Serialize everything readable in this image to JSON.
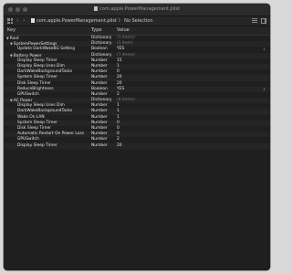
{
  "window": {
    "title": "com.apple.PowerManagement.plist",
    "breadcrumb_file": "com.apple.PowerManagement.plist",
    "breadcrumb_sep": "〉",
    "breadcrumb_selection": "No Selection",
    "traffic_lights": {
      "close": "#5c5c5c",
      "minimize": "#5c5c5c",
      "zoom": "#5c5c5c"
    }
  },
  "toolbar": {
    "back_icon": "‹",
    "forward_icon": "›"
  },
  "columns": {
    "key": "Key",
    "type": "Type",
    "value": "Value"
  },
  "rows": [
    {
      "level": 0,
      "disclosure": "▼",
      "key": "Root",
      "type": "Dictionary",
      "value": "(3 items)",
      "muted": true
    },
    {
      "level": 1,
      "disclosure": "▼",
      "key": "SystemPowerSettings",
      "type": "Dictionary",
      "value": "(1 item)",
      "muted": true
    },
    {
      "level": 2,
      "disclosure": "",
      "key": "Update DarkWakeBG Setting",
      "type": "Boolean",
      "value": "YES",
      "stepper": true
    },
    {
      "level": 1,
      "disclosure": "▼",
      "key": "Battery Power",
      "type": "Dictionary",
      "value": "(7 items)",
      "muted": true
    },
    {
      "level": 2,
      "disclosure": "",
      "key": "Display Sleep Timer",
      "type": "Number",
      "value": "15"
    },
    {
      "level": 2,
      "disclosure": "",
      "key": "Display Sleep Uses Dim",
      "type": "Number",
      "value": "1"
    },
    {
      "level": 2,
      "disclosure": "",
      "key": "DarkWakeBackgroundTasks",
      "type": "Number",
      "value": "0"
    },
    {
      "level": 2,
      "disclosure": "",
      "key": "System Sleep Timer",
      "type": "Number",
      "value": "20"
    },
    {
      "level": 2,
      "disclosure": "",
      "key": "Disk Sleep Timer",
      "type": "Number",
      "value": "20"
    },
    {
      "level": 2,
      "disclosure": "",
      "key": "ReduceBrightness",
      "type": "Boolean",
      "value": "YES",
      "stepper": true
    },
    {
      "level": 2,
      "disclosure": "",
      "key": "GPUSwitch",
      "type": "Number",
      "value": "2"
    },
    {
      "level": 1,
      "disclosure": "▼",
      "key": "AC Power",
      "type": "Dictionary",
      "value": "(8 items)",
      "muted": true
    },
    {
      "level": 2,
      "disclosure": "",
      "key": "Display Sleep Uses Dim",
      "type": "Number",
      "value": "1"
    },
    {
      "level": 2,
      "disclosure": "",
      "key": "DarkWakeBackgroundTasks",
      "type": "Number",
      "value": "1"
    },
    {
      "level": 2,
      "disclosure": "",
      "key": "Wake On LAN",
      "type": "Number",
      "value": "1"
    },
    {
      "level": 2,
      "disclosure": "",
      "key": "System Sleep Timer",
      "type": "Number",
      "value": "0"
    },
    {
      "level": 2,
      "disclosure": "",
      "key": "Disk Sleep Timer",
      "type": "Number",
      "value": "0"
    },
    {
      "level": 2,
      "disclosure": "",
      "key": "Automatic Restart On Power Loss",
      "type": "Number",
      "value": "0"
    },
    {
      "level": 2,
      "disclosure": "",
      "key": "GPUSwitch",
      "type": "Number",
      "value": "2"
    },
    {
      "level": 2,
      "disclosure": "",
      "key": "Display Sleep Timer",
      "type": "Number",
      "value": "20"
    }
  ]
}
